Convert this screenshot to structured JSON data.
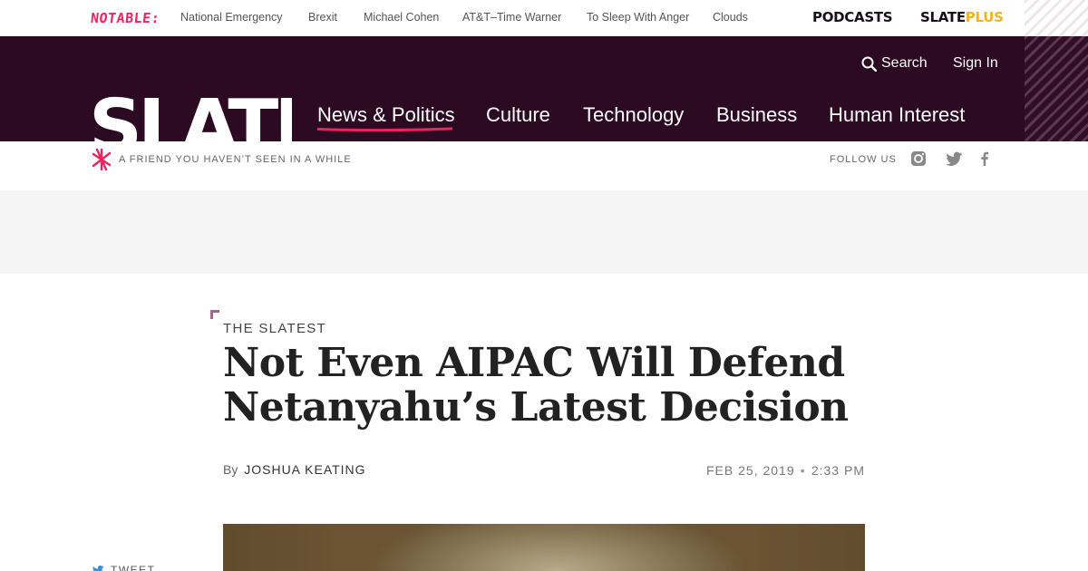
{
  "topbar": {
    "notable": "NOTABLE:",
    "trending": [
      "National Emergency",
      "Brexit",
      "Michael Cohen",
      "AT&T–Time Warner",
      "To Sleep With Anger",
      "Clouds"
    ],
    "podcasts": "PODCASTS",
    "slateplus_a": "SLATE",
    "slateplus_b": "PLUS"
  },
  "header": {
    "search_label": "Search",
    "signin_label": "Sign In",
    "logo_text": "SLATE",
    "nav": [
      "News & Politics",
      "Culture",
      "Technology",
      "Business",
      "Human Interest"
    ],
    "active_nav": "News & Politics"
  },
  "subbar": {
    "tagline": "A friend you haven’t seen in a while",
    "follow_us": "Follow us",
    "social": [
      "instagram-icon",
      "twitter-icon",
      "facebook-icon"
    ]
  },
  "article": {
    "kicker": "The Slatest",
    "headline": "Not Even AIPAC Will Defend Netanyahu’s Latest Decision",
    "by": "By",
    "author": "Joshua Keating",
    "date": "FEB 25, 2019",
    "time": "2:33 PM",
    "share_label": "TWEET"
  },
  "colors": {
    "brand_dark": "#2b0a22",
    "accent_pink": "#e8265d",
    "plus_gold": "#f0b323",
    "kicker_corner": "#a36690"
  }
}
